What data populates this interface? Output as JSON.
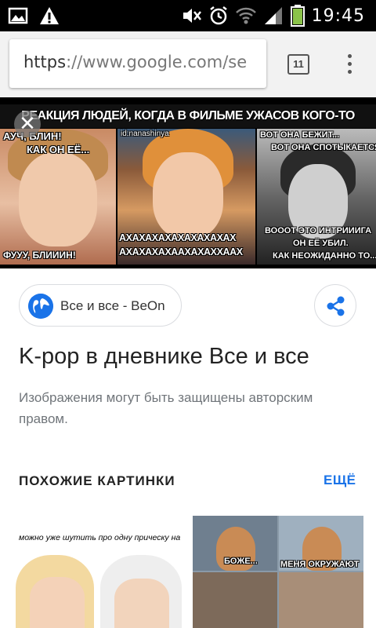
{
  "status_bar": {
    "time": "19:45",
    "icons": [
      "image-icon",
      "warning-icon",
      "mute-icon",
      "alarm-icon",
      "wifi-icon",
      "signal-icon",
      "battery-icon"
    ]
  },
  "browser": {
    "url_scheme": "https",
    "url_rest": "://www.google.com/se",
    "tab_count": "11"
  },
  "image": {
    "title": "РЕАКЦИЯ ЛЮДЕЙ, КОГДА В ФИЛЬМЕ УЖАСОВ КОГО-ТО УБИВАЮТ",
    "panel1": {
      "top_text_1": "АУЧ, БЛИН!",
      "top_text_2": "КАК ОН ЕЁ...",
      "bottom_text": "ФУУУ, БЛИИИН!"
    },
    "panel2": {
      "watermark": "id:nanashinya",
      "line1": "АХАХАХАХАХАХАХАХАХ",
      "line2": "АХАХАХАХААХАХАХХААХ"
    },
    "panel3": {
      "top_text_1": "ВОТ ОНА БЕЖИТ...",
      "top_text_2": "ВОТ ОНА СПОТЫКАЕТСЯ...",
      "bottom_text_1": "ВОООТ ЭТО ИНТРИИИГА",
      "bottom_text_2": "ОН ЕЁ УБИЛ.",
      "bottom_text_3": "КАК НЕОЖИДАННО ТО..."
    }
  },
  "result": {
    "source_label": "Все и все - BeOn",
    "title": "K-pop в дневнике Все и все",
    "copyright": "Изображения могут быть защищены авторским правом."
  },
  "related": {
    "heading": "ПОХОЖИЕ КАРТИНКИ",
    "more_label": "ЕЩЁ",
    "thumb1_caption": "можно уже шутить про одну прическу на всю корею?",
    "thumb2_caption_1": "БОЖЕ...",
    "thumb2_caption_2": "МЕНЯ ОКРУЖАЮТ"
  },
  "colors": {
    "accent": "#1a73e8",
    "statusbar": "#000000",
    "toolbar": "#f2f2f2"
  }
}
